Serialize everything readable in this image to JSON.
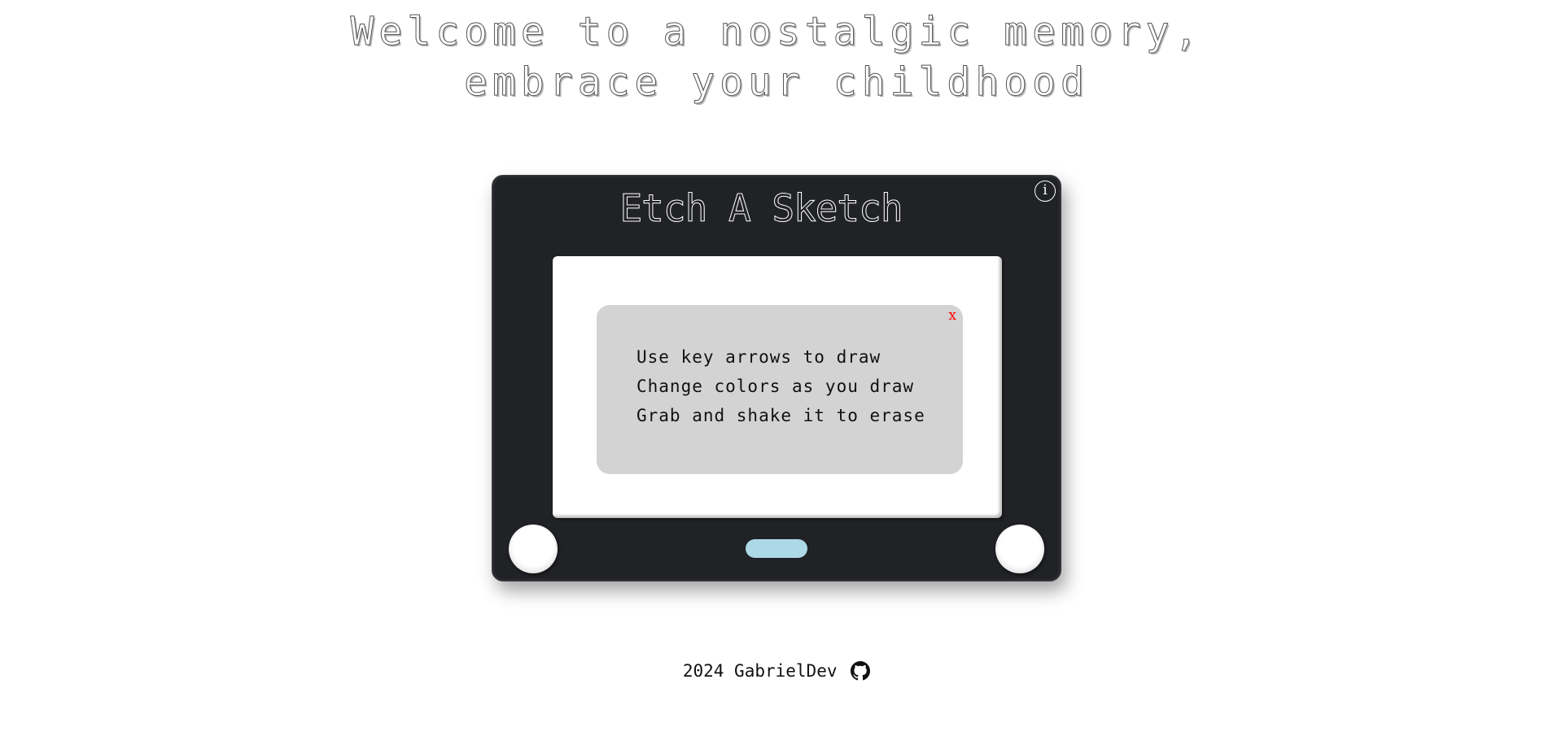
{
  "header": {
    "line1": "Welcome to a nostalgic memory,",
    "line2": "embrace your childhood"
  },
  "device": {
    "title": "Etch A Sketch",
    "info_label": "i",
    "screen_bg": "#ffffff",
    "frame_color": "#212226"
  },
  "instructions": {
    "close_label": "x",
    "lines": [
      "Use key arrows to draw",
      "Change colors as you draw",
      "Grab and shake it to erase"
    ]
  },
  "controls": {
    "color_button_color": "#add8e6",
    "left_knob": "knob",
    "right_knob": "knob"
  },
  "footer": {
    "text": "2024 GabrielDev",
    "icon": "github-icon"
  }
}
